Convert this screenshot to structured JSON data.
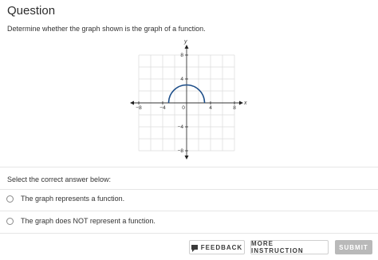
{
  "question": {
    "title": "Question",
    "prompt": "Determine whether the graph shown is the graph of a function."
  },
  "graph": {
    "x_axis_label": "x",
    "y_axis_label": "y",
    "x_tick_labels": [
      "−8",
      "−4",
      "0",
      "4",
      "8"
    ],
    "y_tick_labels": [
      "8",
      "4",
      "−4",
      "−8"
    ],
    "curve_color": "#1d4e89",
    "curve": "upper semicircle centered at (0, 0) with radius 3"
  },
  "answer": {
    "select_label": "Select the correct answer below:",
    "options": [
      {
        "label": "The graph represents a function."
      },
      {
        "label": "The graph does NOT represent a function."
      }
    ]
  },
  "footer": {
    "feedback_label": "FEEDBACK",
    "more_instruction_label": "MORE INSTRUCTION",
    "submit_label": "SUBMIT"
  }
}
